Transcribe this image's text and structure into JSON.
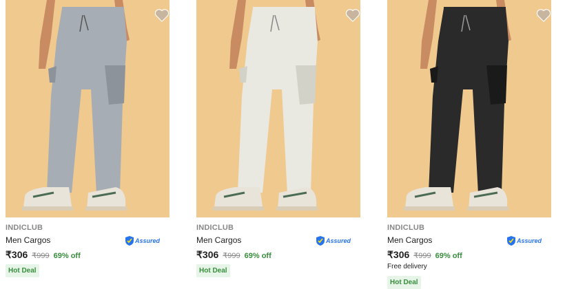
{
  "products": [
    {
      "brand": "INDICLUB",
      "title": "Men Cargos",
      "assured": "Assured",
      "price": "₹306",
      "mrp": "₹999",
      "discount": "69% off",
      "delivery": "",
      "deal": "Hot Deal",
      "pant_color": "#a7adb4",
      "pant_shade": "#8d939a"
    },
    {
      "brand": "INDICLUB",
      "title": "Men Cargos",
      "assured": "Assured",
      "price": "₹306",
      "mrp": "₹999",
      "discount": "69% off",
      "delivery": "",
      "deal": "Hot Deal",
      "pant_color": "#e9e9e2",
      "pant_shade": "#d2d2c9"
    },
    {
      "brand": "INDICLUB",
      "title": "Men Cargos",
      "assured": "Assured",
      "price": "₹306",
      "mrp": "₹999",
      "discount": "69% off",
      "delivery": "Free delivery",
      "deal": "Hot Deal",
      "pant_color": "#2a2a2a",
      "pant_shade": "#1a1a1a"
    }
  ],
  "colors": {
    "background": "#f0c98f",
    "skin": "#c98c62",
    "shoe": "#e9e4da",
    "accent": "#2874f0",
    "green": "#388e3c"
  },
  "icons": {
    "wishlist": "heart-icon",
    "assured": "assured-shield-icon"
  }
}
